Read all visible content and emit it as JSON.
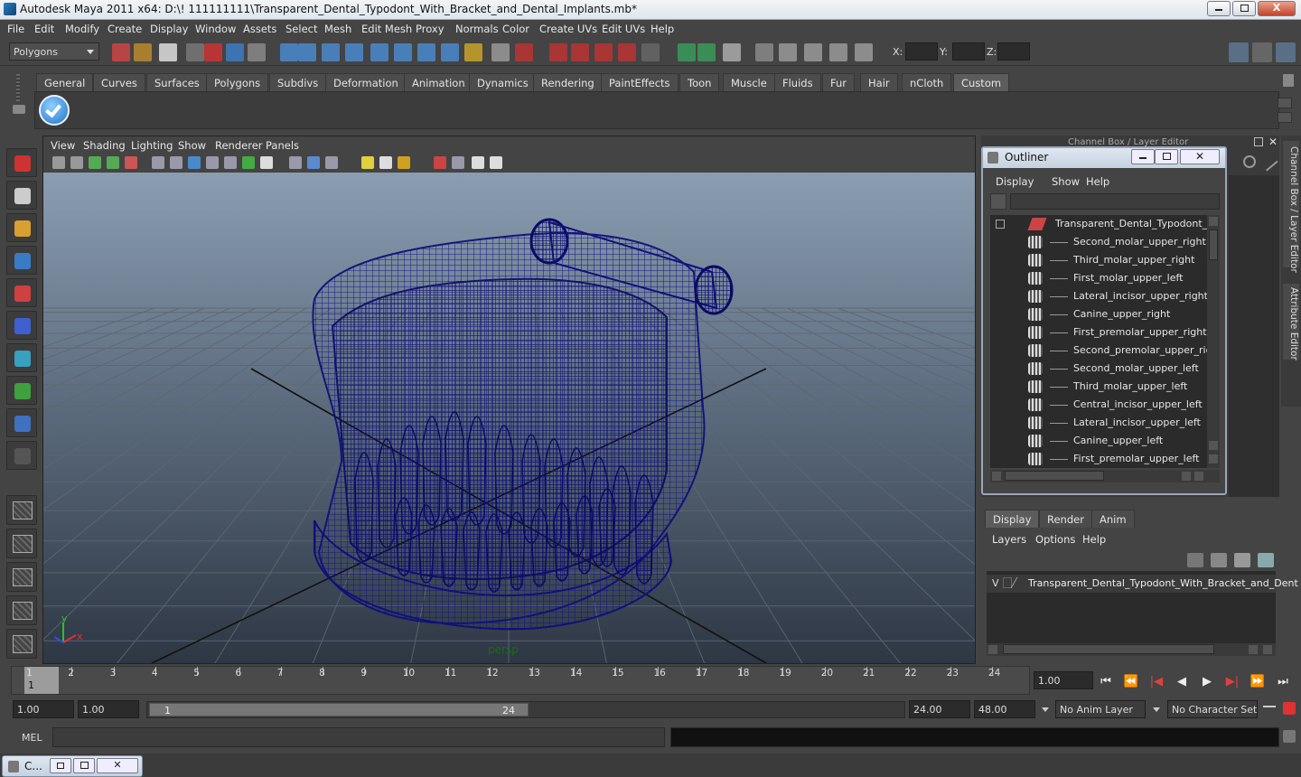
{
  "window": {
    "title": "Autodesk Maya 2011 x64: D:\\! 111111111\\Transparent_Dental_Typodont_With_Bracket_and_Dental_Implants.mb*",
    "min_icon": "minimize-icon",
    "max_icon": "maximize-icon",
    "close_label": "X"
  },
  "menubar": [
    "File",
    "Edit",
    "Modify",
    "Create",
    "Display",
    "Window",
    "Assets",
    "Select",
    "Mesh",
    "Edit Mesh",
    "Proxy",
    "Normals",
    "Color",
    "Create UVs",
    "Edit UVs",
    "Help"
  ],
  "statusline": {
    "mode": "Polygons",
    "x_label": "X:",
    "y_label": "Y:",
    "z_label": "Z:"
  },
  "shelf": {
    "tabs": [
      "General",
      "Curves",
      "Surfaces",
      "Polygons",
      "Subdivs",
      "Deformation",
      "Animation",
      "Dynamics",
      "Rendering",
      "PaintEffects",
      "Toon",
      "Muscle",
      "Fluids",
      "Fur",
      "Hair",
      "nCloth",
      "Custom"
    ],
    "active": "Custom"
  },
  "viewport": {
    "menu": [
      "View",
      "Shading",
      "Lighting",
      "Show",
      "Renderer",
      "Panels"
    ],
    "camera_label": "persp",
    "axis_x": "x",
    "axis_y": "y"
  },
  "outliner": {
    "title": "Outliner",
    "menu": [
      "Display",
      "Show",
      "Help"
    ],
    "root": "Transparent_Dental_Typodont_Wi",
    "items": [
      "Second_molar_upper_right",
      "Third_molar_upper_right",
      "First_molar_upper_left",
      "Lateral_incisor_upper_right",
      "Canine_upper_right",
      "First_premolar_upper_right",
      "Second_premolar_upper_right",
      "Second_molar_upper_left",
      "Third_molar_upper_left",
      "Central_incisor_upper_left",
      "Lateral_incisor_upper_left",
      "Canine_upper_left",
      "First_premolar_upper_left"
    ]
  },
  "chanbox": {
    "title": "Channel Box / Layer Editor",
    "side_tab_1": "Channel Box / Layer Editor",
    "side_tab_2": "Attribute Editor"
  },
  "layers": {
    "tabs": [
      "Display",
      "Render",
      "Anim"
    ],
    "active": "Display",
    "menu": [
      "Layers",
      "Options",
      "Help"
    ],
    "layer_v": "V",
    "layer_name": "Transparent_Dental_Typodont_With_Bracket_and_Dent"
  },
  "timeline": {
    "ticks": [
      "1",
      "2",
      "3",
      "4",
      "5",
      "6",
      "7",
      "8",
      "9",
      "10",
      "11",
      "12",
      "13",
      "14",
      "15",
      "16",
      "17",
      "18",
      "19",
      "20",
      "21",
      "22",
      "23",
      "24"
    ],
    "current_frame": "1",
    "current_time": "1.00"
  },
  "range": {
    "start": "1.00",
    "inner_start": "1.00",
    "slider_start": "1",
    "slider_end": "24",
    "end": "24.00",
    "outer_end": "48.00",
    "anim_layer": "No Anim Layer",
    "char_set": "No Character Set"
  },
  "mel": {
    "label": "MEL"
  },
  "taskbar": {
    "item": "C..."
  }
}
